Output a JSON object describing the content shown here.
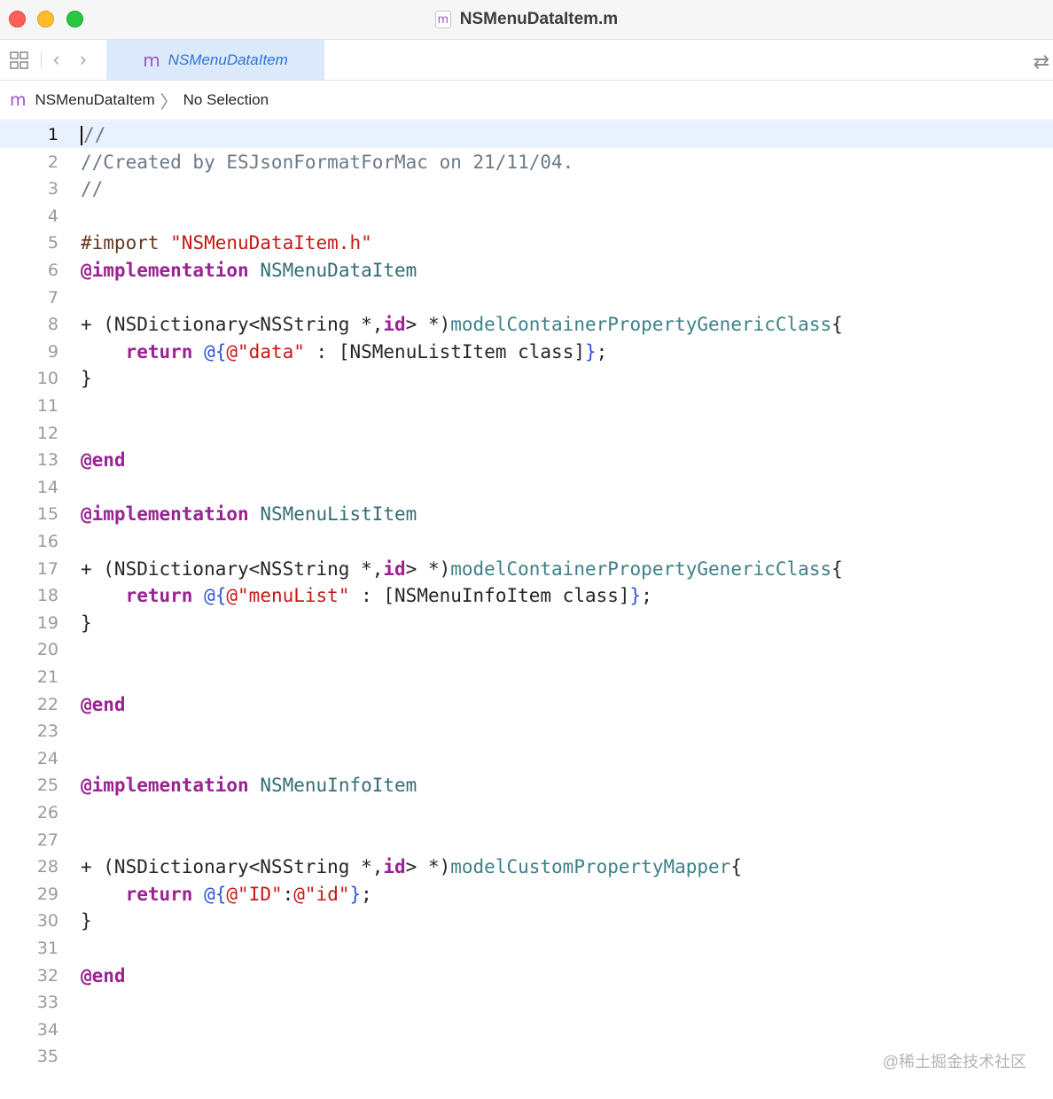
{
  "window": {
    "title": "NSMenuDataItem.m",
    "file_icon_letter": "m"
  },
  "tabbar": {
    "back_glyph": "‹",
    "forward_glyph": "›",
    "tab": {
      "icon_letter": "m",
      "label": "NSMenuDataItem"
    },
    "swap_glyph": "⇄"
  },
  "jumpbar": {
    "icon_letter": "m",
    "file": "NSMenuDataItem",
    "chevron": "〉",
    "selection": "No Selection"
  },
  "editor": {
    "current_line": 1,
    "lines": [
      {
        "n": "1",
        "tokens": [
          {
            "t": "//",
            "c": "cm"
          }
        ]
      },
      {
        "n": "2",
        "tokens": [
          {
            "t": "//Created by ESJsonFormatForMac on 21/11/04.",
            "c": "cm"
          }
        ]
      },
      {
        "n": "3",
        "tokens": [
          {
            "t": "//",
            "c": "cm"
          }
        ]
      },
      {
        "n": "4",
        "tokens": []
      },
      {
        "n": "5",
        "tokens": [
          {
            "t": "#import ",
            "c": "pp"
          },
          {
            "t": "\"NSMenuDataItem.h\"",
            "c": "str"
          }
        ]
      },
      {
        "n": "6",
        "tokens": [
          {
            "t": "@implementation",
            "c": "kw"
          },
          {
            "t": " "
          },
          {
            "t": "NSMenuDataItem",
            "c": "cls"
          }
        ]
      },
      {
        "n": "7",
        "tokens": []
      },
      {
        "n": "8",
        "tokens": [
          {
            "t": "+ (NSDictionary<NSString *,"
          },
          {
            "t": "id",
            "c": "kw"
          },
          {
            "t": "> *)"
          },
          {
            "t": "modelContainerPropertyGenericClass",
            "c": "fn"
          },
          {
            "t": "{"
          }
        ]
      },
      {
        "n": "9",
        "tokens": [
          {
            "t": "    "
          },
          {
            "t": "return",
            "c": "kw"
          },
          {
            "t": " "
          },
          {
            "t": "@{",
            "c": "lit"
          },
          {
            "t": "@\"data\"",
            "c": "str"
          },
          {
            "t": " : [NSMenuListItem class]"
          },
          {
            "t": "}",
            "c": "lit"
          },
          {
            "t": ";"
          }
        ]
      },
      {
        "n": "10",
        "tokens": [
          {
            "t": "}"
          }
        ]
      },
      {
        "n": "11",
        "tokens": []
      },
      {
        "n": "12",
        "tokens": []
      },
      {
        "n": "13",
        "tokens": [
          {
            "t": "@end",
            "c": "kw"
          }
        ]
      },
      {
        "n": "14",
        "tokens": []
      },
      {
        "n": "15",
        "tokens": [
          {
            "t": "@implementation",
            "c": "kw"
          },
          {
            "t": " "
          },
          {
            "t": "NSMenuListItem",
            "c": "cls"
          }
        ]
      },
      {
        "n": "16",
        "tokens": []
      },
      {
        "n": "17",
        "tokens": [
          {
            "t": "+ (NSDictionary<NSString *,"
          },
          {
            "t": "id",
            "c": "kw"
          },
          {
            "t": "> *)"
          },
          {
            "t": "modelContainerPropertyGenericClass",
            "c": "fn"
          },
          {
            "t": "{"
          }
        ]
      },
      {
        "n": "18",
        "tokens": [
          {
            "t": "    "
          },
          {
            "t": "return",
            "c": "kw"
          },
          {
            "t": " "
          },
          {
            "t": "@{",
            "c": "lit"
          },
          {
            "t": "@\"menuList\"",
            "c": "str"
          },
          {
            "t": " : [NSMenuInfoItem class]"
          },
          {
            "t": "}",
            "c": "lit"
          },
          {
            "t": ";"
          }
        ]
      },
      {
        "n": "19",
        "tokens": [
          {
            "t": "}"
          }
        ]
      },
      {
        "n": "20",
        "tokens": []
      },
      {
        "n": "21",
        "tokens": []
      },
      {
        "n": "22",
        "tokens": [
          {
            "t": "@end",
            "c": "kw"
          }
        ]
      },
      {
        "n": "23",
        "tokens": []
      },
      {
        "n": "24",
        "tokens": []
      },
      {
        "n": "25",
        "tokens": [
          {
            "t": "@implementation",
            "c": "kw"
          },
          {
            "t": " "
          },
          {
            "t": "NSMenuInfoItem",
            "c": "cls"
          }
        ]
      },
      {
        "n": "26",
        "tokens": []
      },
      {
        "n": "27",
        "tokens": []
      },
      {
        "n": "28",
        "tokens": [
          {
            "t": "+ (NSDictionary<NSString *,"
          },
          {
            "t": "id",
            "c": "kw"
          },
          {
            "t": "> *)"
          },
          {
            "t": "modelCustomPropertyMapper",
            "c": "fn"
          },
          {
            "t": "{"
          }
        ]
      },
      {
        "n": "29",
        "tokens": [
          {
            "t": "    "
          },
          {
            "t": "return",
            "c": "kw"
          },
          {
            "t": " "
          },
          {
            "t": "@{",
            "c": "lit"
          },
          {
            "t": "@\"ID\"",
            "c": "str"
          },
          {
            "t": ":"
          },
          {
            "t": "@\"id\"",
            "c": "str"
          },
          {
            "t": "}",
            "c": "lit"
          },
          {
            "t": ";"
          }
        ]
      },
      {
        "n": "30",
        "tokens": [
          {
            "t": "}"
          }
        ]
      },
      {
        "n": "31",
        "tokens": []
      },
      {
        "n": "32",
        "tokens": [
          {
            "t": "@end",
            "c": "kw"
          }
        ]
      },
      {
        "n": "33",
        "tokens": []
      },
      {
        "n": "34",
        "tokens": []
      },
      {
        "n": "35",
        "tokens": []
      }
    ]
  },
  "watermark": "@稀土掘金技术社区"
}
